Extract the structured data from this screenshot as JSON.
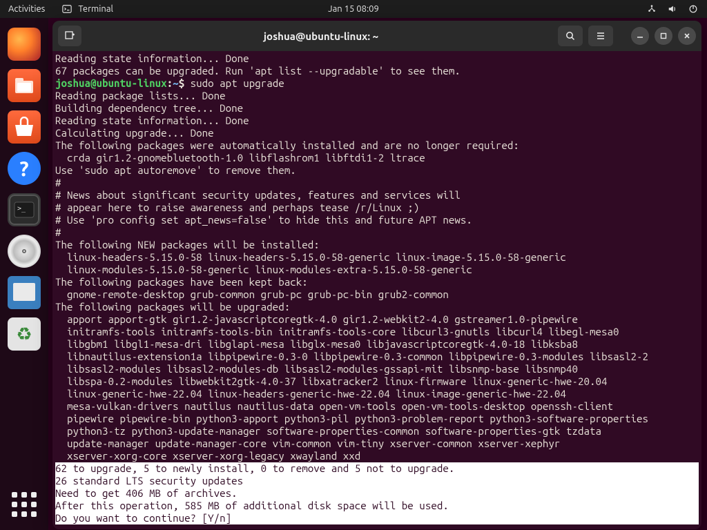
{
  "panel": {
    "activities": "Activities",
    "app_name": "Terminal",
    "clock": "Jan 15  08:09"
  },
  "window": {
    "title": "joshua@ubuntu-linux: ~"
  },
  "term": {
    "l00": "Reading state information... Done",
    "l01": "67 packages can be upgraded. Run 'apt list --upgradable' to see them.",
    "prompt_user": "joshua@ubuntu-linux",
    "prompt_colon": ":",
    "prompt_path": "~",
    "prompt_dollar": "$ ",
    "cmd": "sudo apt upgrade",
    "l02": "Reading package lists... Done",
    "l03": "Building dependency tree... Done",
    "l04": "Reading state information... Done",
    "l05": "Calculating upgrade... Done",
    "l06": "The following packages were automatically installed and are no longer required:",
    "l07": "  crda gir1.2-gnomebluetooth-1.0 libflashrom1 libftdi1-2 ltrace",
    "l08": "Use 'sudo apt autoremove' to remove them.",
    "l09": "#",
    "l10": "# News about significant security updates, features and services will",
    "l11": "# appear here to raise awareness and perhaps tease /r/Linux ;)",
    "l12": "# Use 'pro config set apt_news=false' to hide this and future APT news.",
    "l13": "#",
    "l14": "The following NEW packages will be installed:",
    "l15": "  linux-headers-5.15.0-58 linux-headers-5.15.0-58-generic linux-image-5.15.0-58-generic",
    "l16": "  linux-modules-5.15.0-58-generic linux-modules-extra-5.15.0-58-generic",
    "l17": "The following packages have been kept back:",
    "l18": "  gnome-remote-desktop grub-common grub-pc grub-pc-bin grub2-common",
    "l19": "The following packages will be upgraded:",
    "l20": "  apport apport-gtk gir1.2-javascriptcoregtk-4.0 gir1.2-webkit2-4.0 gstreamer1.0-pipewire",
    "l21": "  initramfs-tools initramfs-tools-bin initramfs-tools-core libcurl3-gnutls libcurl4 libegl-mesa0",
    "l22": "  libgbm1 libgl1-mesa-dri libglapi-mesa libglx-mesa0 libjavascriptcoregtk-4.0-18 libksba8",
    "l23": "  libnautilus-extension1a libpipewire-0.3-0 libpipewire-0.3-common libpipewire-0.3-modules libsasl2-2",
    "l24": "  libsasl2-modules libsasl2-modules-db libsasl2-modules-gssapi-mit libsnmp-base libsnmp40",
    "l25": "  libspa-0.2-modules libwebkit2gtk-4.0-37 libxatracker2 linux-firmware linux-generic-hwe-20.04",
    "l26": "  linux-generic-hwe-22.04 linux-headers-generic-hwe-22.04 linux-image-generic-hwe-22.04",
    "l27": "  mesa-vulkan-drivers nautilus nautilus-data open-vm-tools open-vm-tools-desktop openssh-client",
    "l28": "  pipewire pipewire-bin python3-apport python3-pil python3-problem-report python3-software-properties",
    "l29": "  python3-tz python3-update-manager software-properties-common software-properties-gtk tzdata",
    "l30": "  update-manager update-manager-core vim-common vim-tiny xserver-common xserver-xephyr",
    "l31": "  xserver-xorg-core xserver-xorg-legacy xwayland xxd",
    "s0": "62 to upgrade, 5 to newly install, 0 to remove and 5 not to upgrade.",
    "s1": "26 standard LTS security updates",
    "s2": "Need to get 406 MB of archives.",
    "s3": "After this operation, 585 MB of additional disk space will be used.",
    "s4": "Do you want to continue? [Y/n] "
  }
}
